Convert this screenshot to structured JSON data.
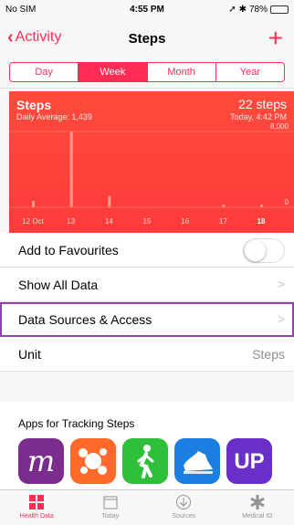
{
  "status": {
    "carrier": "No SIM",
    "time": "4:55 PM",
    "battery": "78%"
  },
  "nav": {
    "back_label": "Activity",
    "title": "Steps",
    "add_label": "+"
  },
  "segments": [
    {
      "label": "Day",
      "active": false
    },
    {
      "label": "Week",
      "active": true
    },
    {
      "label": "Month",
      "active": false
    },
    {
      "label": "Year",
      "active": false
    }
  ],
  "chart_data": {
    "type": "bar",
    "title": "Steps",
    "subtitle": "Daily Average: 1,439",
    "total": "22 steps",
    "time_label": "Today, 4:42 PM",
    "categories": [
      "12 Oct",
      "13",
      "14",
      "15",
      "16",
      "17",
      "18"
    ],
    "values": [
      700,
      8000,
      1200,
      0,
      0,
      200,
      22
    ],
    "ylim": [
      0,
      8000
    ],
    "y_tick_labels": [
      "8,000",
      "0"
    ],
    "colors": {
      "background": "#ff3b3b",
      "bars": "#ff8a7a"
    }
  },
  "rows": {
    "favourites": {
      "label": "Add to Favourites"
    },
    "show_all": {
      "label": "Show All Data",
      "chevron": ">"
    },
    "sources": {
      "label": "Data Sources & Access",
      "chevron": ">"
    },
    "unit": {
      "label": "Unit",
      "value": "Steps"
    }
  },
  "apps": {
    "header": "Apps for Tracking Steps",
    "items": [
      {
        "name": "m",
        "color": "#7b2d8e",
        "icon": "moves-m-icon"
      },
      {
        "name": "",
        "color": "#ff6a2b",
        "icon": "orange-hub-icon"
      },
      {
        "name": "",
        "color": "#2fbf3a",
        "icon": "walking-person-icon"
      },
      {
        "name": "",
        "color": "#1a7fe0",
        "icon": "shoe-icon"
      },
      {
        "name": "UP",
        "color": "#6a2fc9",
        "icon": "up-icon"
      }
    ]
  },
  "tabs": [
    {
      "label": "Health Data",
      "active": true
    },
    {
      "label": "Today",
      "active": false
    },
    {
      "label": "Sources",
      "active": false
    },
    {
      "label": "Medical ID",
      "active": false
    }
  ],
  "colors": {
    "accent": "#ff2d55",
    "highlight": "#8e44ad"
  }
}
